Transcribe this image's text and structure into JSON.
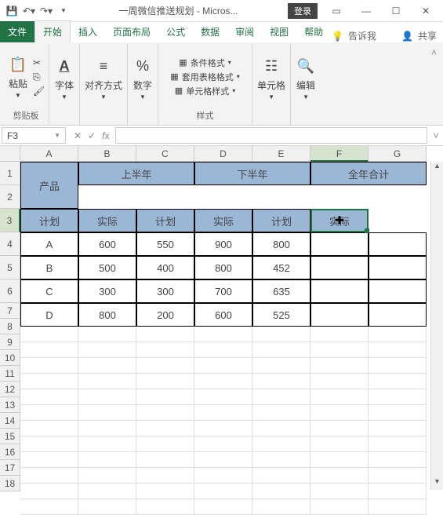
{
  "titlebar": {
    "title": "一周微信推送规划 - Micros...",
    "login": "登录"
  },
  "tabs": {
    "file": "文件",
    "home": "开始",
    "insert": "插入",
    "layout": "页面布局",
    "formulas": "公式",
    "data": "数据",
    "review": "审阅",
    "view": "视图",
    "help": "帮助",
    "tellme": "告诉我",
    "share": "共享"
  },
  "ribbon": {
    "clipboard": {
      "paste": "粘贴",
      "label": "剪贴板"
    },
    "font": {
      "btn": "字体",
      "label": ""
    },
    "align": {
      "btn": "对齐方式",
      "label": ""
    },
    "number": {
      "btn": "数字",
      "label": ""
    },
    "styles": {
      "cond": "条件格式",
      "table": "套用表格格式",
      "cell": "单元格样式",
      "label": "样式"
    },
    "cells": {
      "btn": "单元格",
      "label": ""
    },
    "editing": {
      "btn": "编辑",
      "label": ""
    }
  },
  "namebox": "F3",
  "cols": [
    "A",
    "B",
    "C",
    "D",
    "E",
    "F",
    "G"
  ],
  "rows": [
    "1",
    "2",
    "3",
    "4",
    "5",
    "6",
    "7",
    "8",
    "9",
    "10",
    "11",
    "12",
    "13",
    "14",
    "15",
    "16",
    "17",
    "18"
  ],
  "table": {
    "h_product": "产品",
    "h_first": "上半年",
    "h_second": "下半年",
    "h_total": "全年合计",
    "h_plan": "计划",
    "h_actual": "实际",
    "rows": [
      {
        "p": "A",
        "b": "600",
        "c": "550",
        "d": "900",
        "e": "800"
      },
      {
        "p": "B",
        "b": "500",
        "c": "400",
        "d": "800",
        "e": "452"
      },
      {
        "p": "C",
        "b": "300",
        "c": "300",
        "d": "700",
        "e": "635"
      },
      {
        "p": "D",
        "b": "800",
        "c": "200",
        "d": "600",
        "e": "525"
      }
    ]
  },
  "chart_data": {
    "type": "table",
    "title": "",
    "columns": [
      "产品",
      "上半年 计划",
      "上半年 实际",
      "下半年 计划",
      "下半年 实际",
      "全年合计 计划",
      "全年合计 实际"
    ],
    "rows": [
      [
        "A",
        600,
        550,
        900,
        800,
        null,
        null
      ],
      [
        "B",
        500,
        400,
        800,
        452,
        null,
        null
      ],
      [
        "C",
        300,
        300,
        700,
        635,
        null,
        null
      ],
      [
        "D",
        800,
        200,
        600,
        525,
        null,
        null
      ]
    ]
  }
}
